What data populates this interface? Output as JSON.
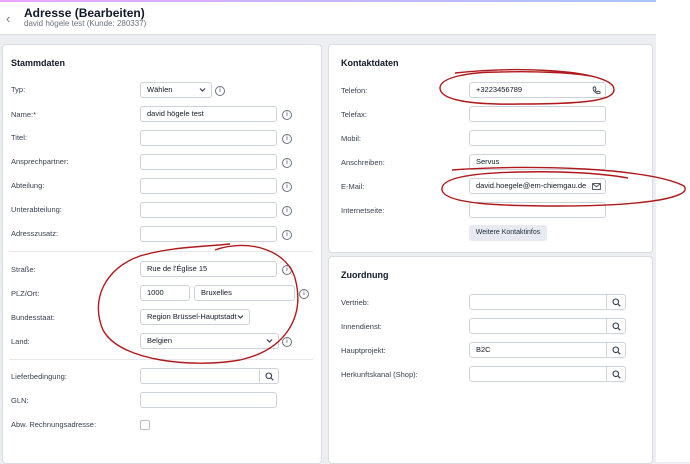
{
  "header": {
    "title": "Adresse (Bearbeiten)",
    "subtitle": "david högele test (Kunde: 280337)"
  },
  "stammdaten": {
    "title": "Stammdaten",
    "typ": {
      "label": "Typ:",
      "value": "Wählen"
    },
    "name": {
      "label": "Name:*",
      "value": "david högele test"
    },
    "titel": {
      "label": "Titel:",
      "value": ""
    },
    "ansprechpartner": {
      "label": "Ansprechpartner:",
      "value": ""
    },
    "abteilung": {
      "label": "Abteilung:",
      "value": ""
    },
    "unterabteilung": {
      "label": "Unterabteilung:",
      "value": ""
    },
    "adresszusatz": {
      "label": "Adresszusatz:",
      "value": ""
    },
    "strasse": {
      "label": "Straße:",
      "value": "Rue de l'Église 15"
    },
    "plzort": {
      "label": "PLZ/Ort:",
      "plz": "1000",
      "ort": "Bruxelles"
    },
    "bundesstaat": {
      "label": "Bundesstaat:",
      "value": "Region Brüssel-Hauptstadt"
    },
    "land": {
      "label": "Land:",
      "value": "Belgien"
    },
    "lieferbedingung": {
      "label": "Lieferbedingung:",
      "value": ""
    },
    "gln": {
      "label": "GLN:",
      "value": ""
    },
    "abw": {
      "label": "Abw. Rechnungsadresse:"
    }
  },
  "kontakt": {
    "title": "Kontaktdaten",
    "telefon": {
      "label": "Telefon:",
      "value": "+3223456789"
    },
    "telefax": {
      "label": "Telefax:",
      "value": ""
    },
    "mobil": {
      "label": "Mobil:",
      "value": ""
    },
    "anschreiben": {
      "label": "Anschreiben:",
      "value": "Servus"
    },
    "email": {
      "label": "E-Mail:",
      "value": "david.hoegele@em-chiemgau.de"
    },
    "internetseite": {
      "label": "Internetseite:",
      "value": ""
    },
    "more_button": "Weitere Kontaktinfos"
  },
  "zuordnung": {
    "title": "Zuordnung",
    "vertrieb": {
      "label": "Vertrieb:",
      "value": ""
    },
    "innendienst": {
      "label": "Innendienst:",
      "value": ""
    },
    "hauptprojekt": {
      "label": "Hauptprojekt:",
      "value": "B2C"
    },
    "herkunftskanal": {
      "label": "Herkunftskanal (Shop):",
      "value": ""
    }
  },
  "icons": {
    "back": "chevron-left-icon",
    "info": "info-icon",
    "search": "search-icon",
    "phone": "phone-icon",
    "mail": "mail-icon",
    "chevron": "chevron-down-icon"
  },
  "colors": {
    "annotation": "#b0191c",
    "panel_bg": "#ffffff",
    "page_bg": "#eceef2"
  }
}
